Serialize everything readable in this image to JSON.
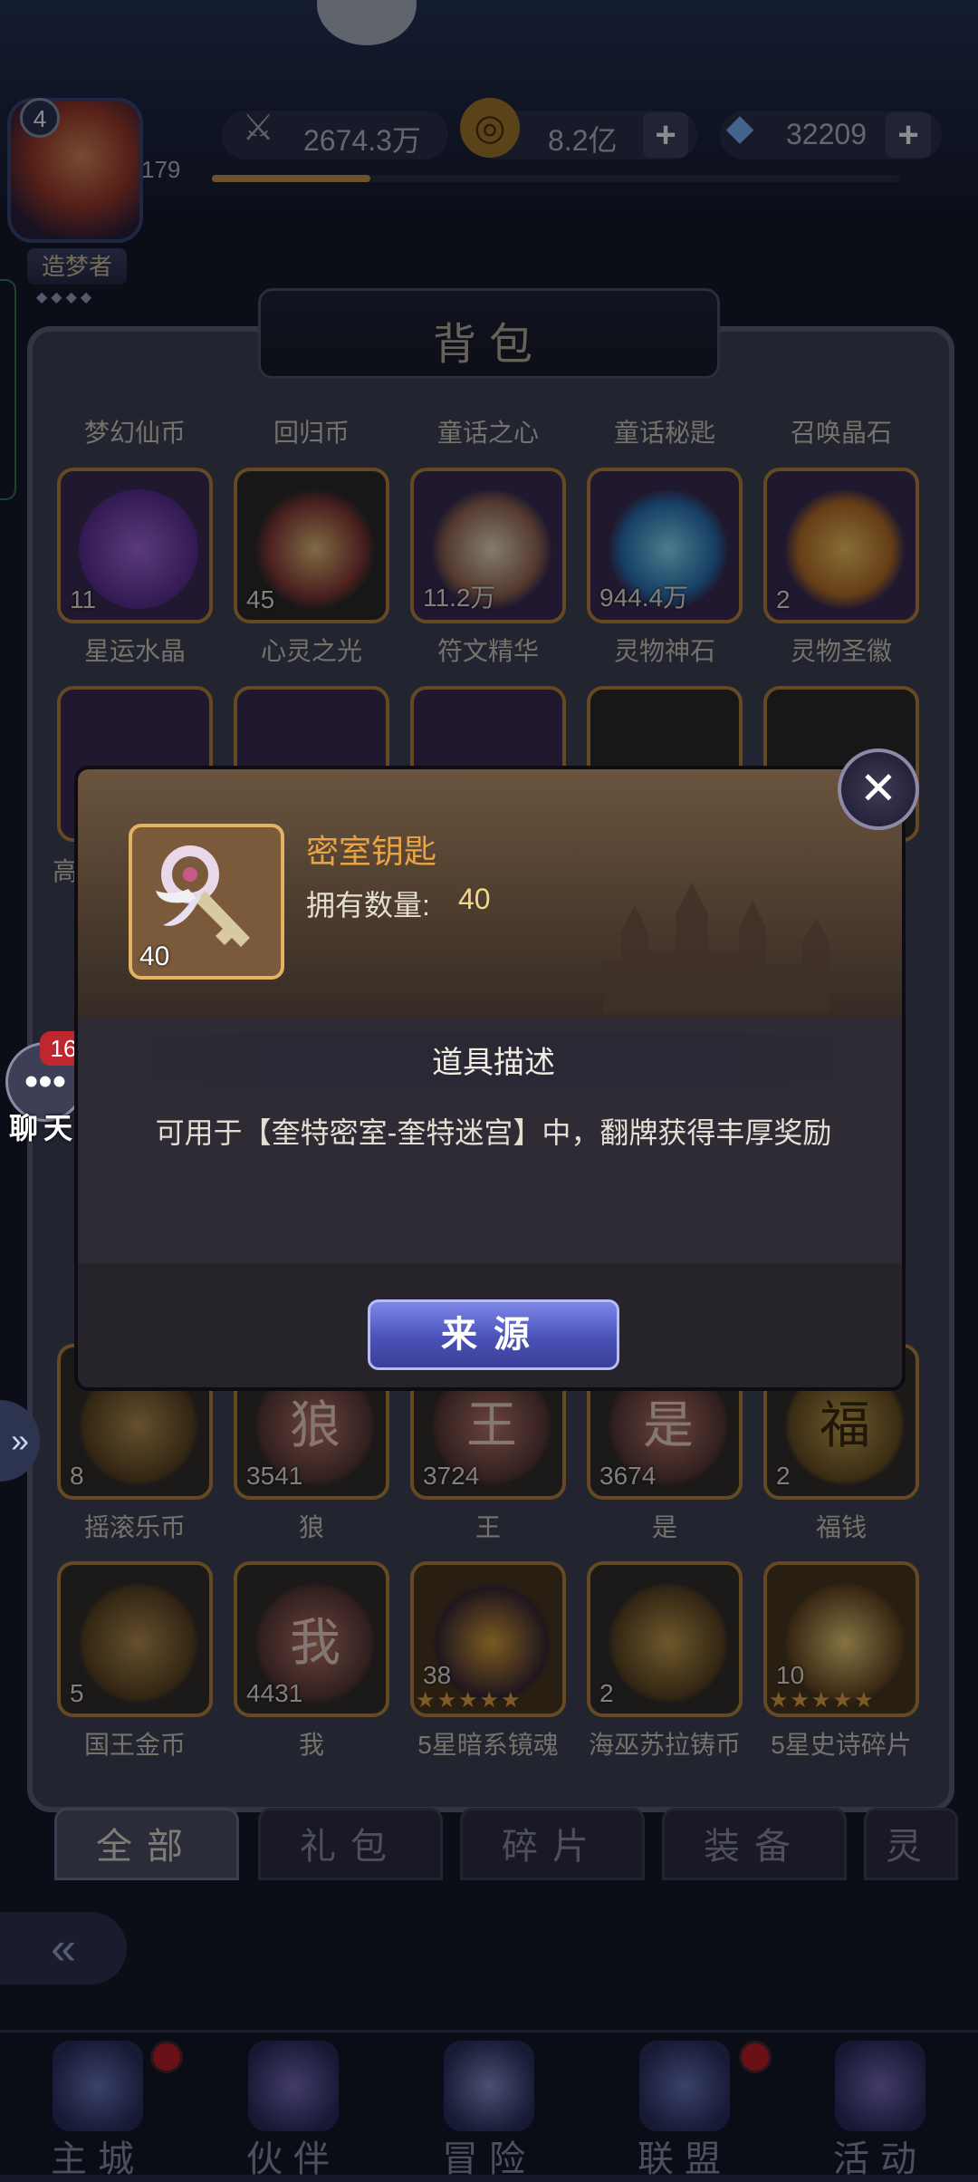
{
  "header": {
    "avatar_level": "4",
    "avatar_number": "179",
    "player_title": "造梦者",
    "resources": [
      {
        "icon": "sword-icon",
        "value": "2674.3万"
      },
      {
        "icon": "gold-coin-icon",
        "value": "8.2亿"
      },
      {
        "icon": "diamond-icon",
        "value": "32209"
      }
    ],
    "exp_fraction": 0.23
  },
  "bag": {
    "title": "背包",
    "row0_labels": [
      "梦幻仙币",
      "回归币",
      "童话之心",
      "童话秘匙",
      "召唤晶石"
    ],
    "row1": [
      {
        "qty": "11",
        "label": "星运水晶",
        "icon": "purple-star-icon"
      },
      {
        "qty": "45",
        "label": "心灵之光",
        "icon": "compass-star-icon"
      },
      {
        "qty": "11.2万",
        "label": "符文精华",
        "icon": "rune-swirl-icon"
      },
      {
        "qty": "944.4万",
        "label": "灵物神石",
        "icon": "blue-crystal-icon"
      },
      {
        "qty": "2",
        "label": "灵物圣徽",
        "icon": "gold-emblem-icon"
      }
    ],
    "row2_partial_label": "高",
    "row3": [
      {
        "qty": "8",
        "label": "摇滚乐币",
        "icon": "guitar-coin-icon"
      },
      {
        "qty": "3541",
        "label": "狼",
        "icon": "wolf-coin-icon",
        "glyph": "狼"
      },
      {
        "qty": "3724",
        "label": "王",
        "icon": "king-coin-icon",
        "glyph": "王"
      },
      {
        "qty": "3674",
        "label": "是",
        "icon": "shi-coin-icon",
        "glyph": "是"
      },
      {
        "qty": "2",
        "label": "福钱",
        "icon": "fortune-coin-icon",
        "glyph": "福"
      }
    ],
    "row4": [
      {
        "qty": "5",
        "label": "国王金币",
        "icon": "crown-coin-icon"
      },
      {
        "qty": "4431",
        "label": "我",
        "icon": "wo-coin-icon",
        "glyph": "我"
      },
      {
        "qty": "38",
        "label": "5星暗系镜魂",
        "icon": "dark-mirror-soul-icon",
        "stars": 5
      },
      {
        "qty": "2",
        "label": "海巫苏拉铸币",
        "icon": "sea-witch-coin-icon"
      },
      {
        "qty": "10",
        "label": "5星史诗碎片",
        "icon": "epic-shard-icon",
        "stars": 5
      }
    ]
  },
  "popup": {
    "item_name": "密室钥匙",
    "item_qty": "40",
    "owned_label": "拥有数量:",
    "owned_value": "40",
    "desc_title": "道具描述",
    "desc_text": "可用于【奎特密室-奎特迷宫】中，翻牌获得丰厚奖励",
    "source_button": "来源",
    "item_icon": "winged-key-icon"
  },
  "chat": {
    "badge": "16",
    "label": "聊天"
  },
  "tabs": [
    "全部",
    "礼包",
    "碎片",
    "装备",
    "灵"
  ],
  "active_tab": 0,
  "nav": [
    {
      "label": "主城",
      "icon": "castle-icon",
      "dot": true
    },
    {
      "label": "伙伴",
      "icon": "witch-hat-icon",
      "dot": false
    },
    {
      "label": "冒险",
      "icon": "adventure-compass-icon",
      "dot": false
    },
    {
      "label": "联盟",
      "icon": "alliance-shield-icon",
      "dot": true
    },
    {
      "label": "活动",
      "icon": "cards-icon",
      "dot": false
    }
  ],
  "colors": {
    "accent_gold": "#e7a444",
    "button_blue": "#4a52b8",
    "badge_red": "#c0262d"
  }
}
